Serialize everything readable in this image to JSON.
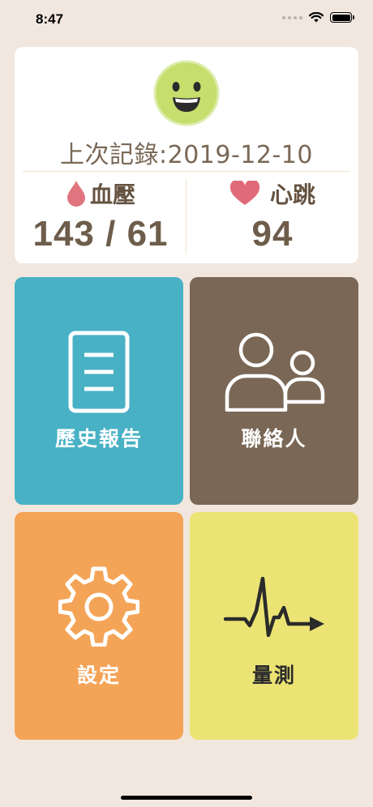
{
  "status_bar": {
    "time": "8:47",
    "icons": [
      "signal-dots-icon",
      "wifi-icon",
      "battery-icon"
    ]
  },
  "summary": {
    "mood_icon": "smiley-face-icon",
    "last_record_label": "上次記錄:2019-12-10",
    "blood_pressure": {
      "icon": "blood-drop-icon",
      "label": "血壓",
      "value": "143 / 61"
    },
    "heart_rate": {
      "icon": "heart-icon",
      "label": "心跳",
      "value": "94"
    }
  },
  "menu": {
    "history": {
      "label": "歷史報告",
      "icon": "document-icon",
      "color": "#48b1c5"
    },
    "contacts": {
      "label": "聯絡人",
      "icon": "people-icon",
      "color": "#7a6756"
    },
    "settings": {
      "label": "設定",
      "icon": "gear-icon",
      "color": "#f4a457"
    },
    "measure": {
      "label": "量測",
      "icon": "heartbeat-arrow-icon",
      "color": "#ebe474"
    }
  },
  "colors": {
    "background": "#f1e7df",
    "drop": "#e07580",
    "heart": "#e06a7a",
    "smiley": "#c5de6c"
  }
}
